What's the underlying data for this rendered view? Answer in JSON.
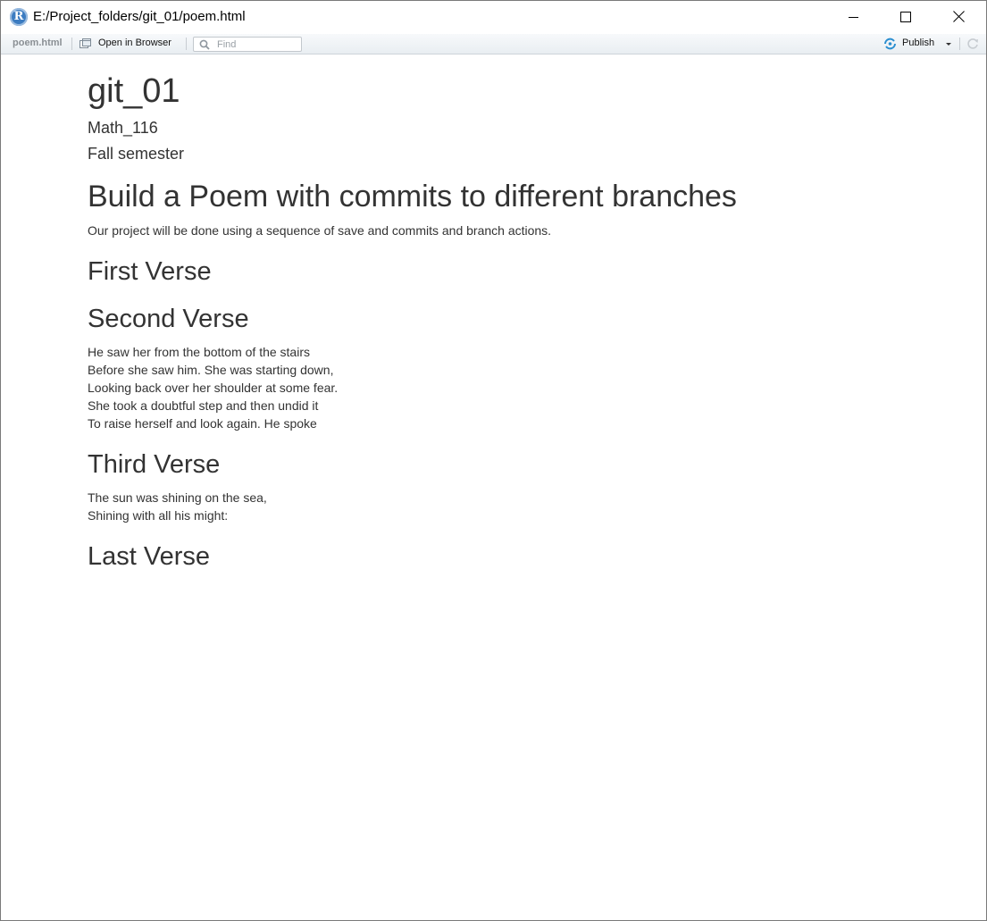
{
  "window": {
    "title": "E:/Project_folders/git_01/poem.html",
    "app_icon_letter": "R"
  },
  "toolbar": {
    "file_label": "poem.html",
    "open_in_browser_label": "Open in Browser",
    "find_placeholder": "Find",
    "publish_label": "Publish"
  },
  "document": {
    "title": "git_01",
    "author": "Math_116",
    "date": "Fall semester",
    "heading": "Build a Poem with commits to different branches",
    "intro": "Our project will be done using a sequence of save and commits and branch actions.",
    "sections": [
      {
        "heading": "First Verse",
        "lines": []
      },
      {
        "heading": "Second Verse",
        "lines": [
          "He saw her from the bottom of the stairs",
          "Before she saw him. She was starting down,",
          "Looking back over her shoulder at some fear.",
          "She took a doubtful step and then undid it",
          "To raise herself and look again. He spoke"
        ]
      },
      {
        "heading": "Third Verse",
        "lines": [
          "The sun was shining on the sea,",
          "Shining with all his might:"
        ]
      },
      {
        "heading": "Last Verse",
        "lines": []
      }
    ]
  },
  "icons": {
    "app": "r-logo-icon",
    "browser": "browser-window-icon",
    "find": "search-icon",
    "publish": "publish-icon",
    "refresh": "refresh-icon"
  },
  "colors": {
    "app_icon": "#3c7cc1",
    "publish_accent": "#2a8ed0",
    "text": "#333333"
  }
}
